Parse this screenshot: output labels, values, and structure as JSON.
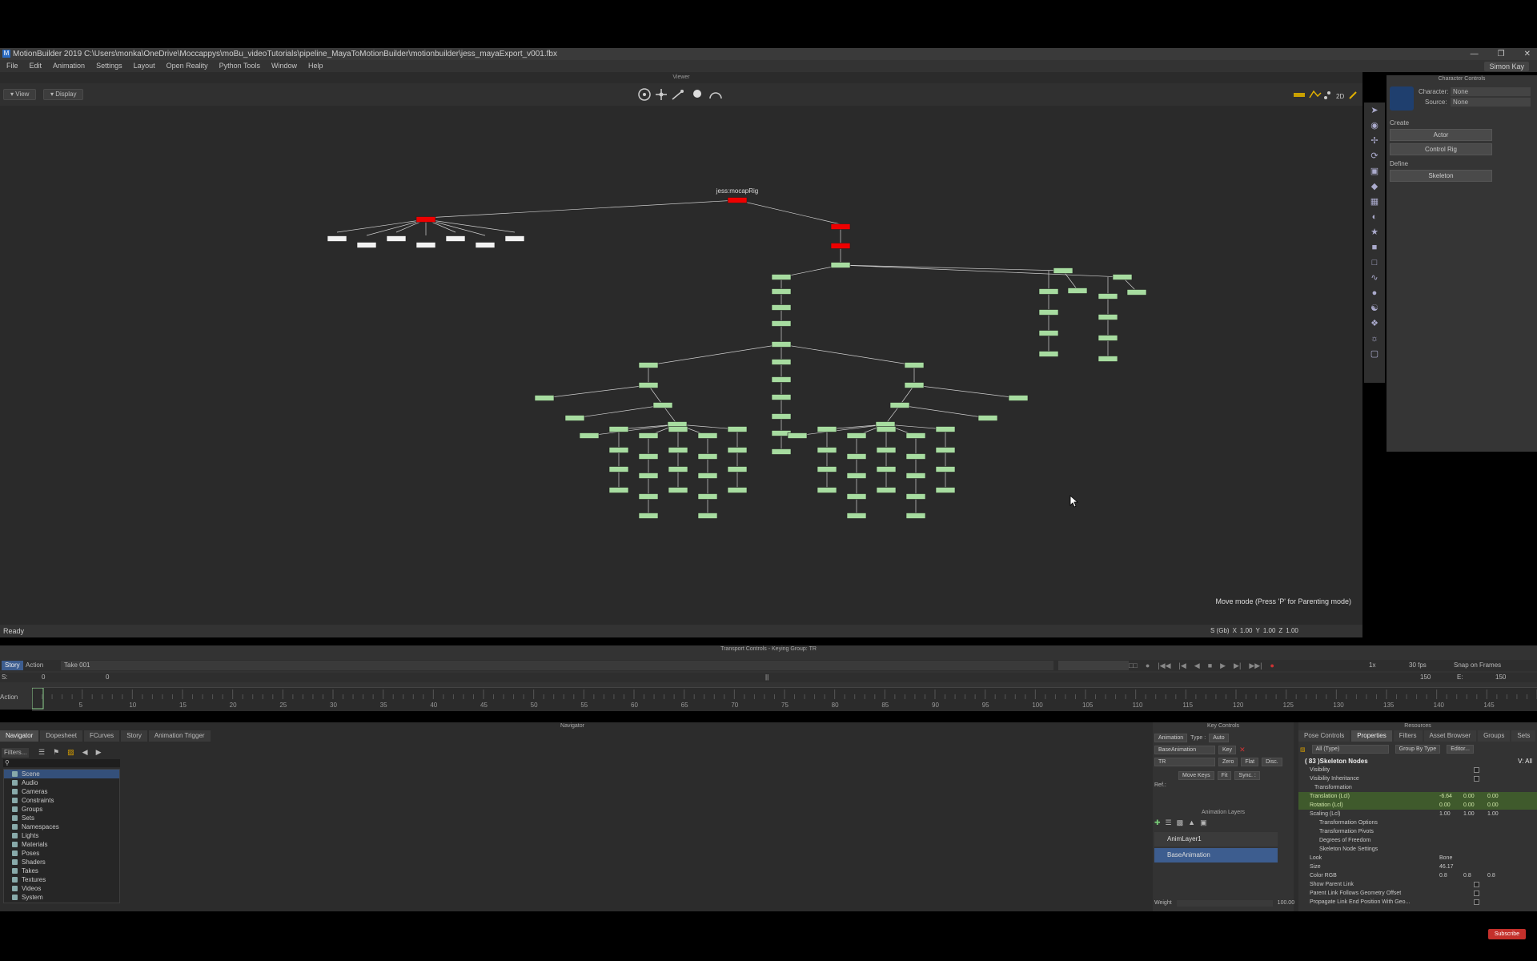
{
  "window": {
    "title": "MotionBuilder 2019    C:\\Users\\monka\\OneDrive\\Moccappys\\moBu_videoTutorials\\pipeline_MayaToMotionBuilder\\motionbuilder\\jess_mayaExport_v001.fbx",
    "user": "Simon Kay"
  },
  "menu": [
    "File",
    "Edit",
    "Animation",
    "Settings",
    "Layout",
    "Open Reality",
    "Python Tools",
    "Window",
    "Help"
  ],
  "viewer": {
    "title": "Viewer",
    "view_label": "View",
    "display_label": "Display",
    "mode_2d": "2D",
    "root_label": "jess:mocapRig",
    "hint": "Move mode (Press 'P' for Parenting mode)"
  },
  "status": {
    "text": "Ready",
    "s_label": "S (Gb)",
    "x_label": "X",
    "x_value": "1.00",
    "y_label": "Y",
    "y_value": "1.00",
    "z_label": "Z",
    "z_value": "1.00"
  },
  "character_controls": {
    "title": "Character Controls",
    "character_label": "Character:",
    "character_value": "None",
    "source_label": "Source:",
    "source_value": "None",
    "create_label": "Create",
    "actor_btn": "Actor",
    "control_rig_btn": "Control Rig",
    "define_label": "Define",
    "skeleton_btn": "Skeleton"
  },
  "transport": {
    "title": "Transport Controls - Keying Group: TR",
    "story_tab": "Story",
    "action_tab": "Action",
    "take": "Take 001",
    "speed": "1x",
    "fps": "30 fps",
    "snap": "Snap on Frames",
    "start_label": "S:",
    "start_value": "0",
    "current_value": "0",
    "end_label": "E:",
    "end_value": "150",
    "end_display": "150",
    "ruler_label": "Action",
    "ticks": [
      "5",
      "10",
      "15",
      "20",
      "25",
      "30",
      "35",
      "40",
      "45",
      "50",
      "55",
      "60",
      "65",
      "70",
      "75",
      "80",
      "85",
      "90",
      "95",
      "100",
      "105",
      "110",
      "115",
      "120",
      "125",
      "130",
      "135",
      "140",
      "145"
    ]
  },
  "navigator": {
    "title": "Navigator",
    "tabs": [
      "Navigator",
      "Dopesheet",
      "FCurves",
      "Story",
      "Animation Trigger"
    ],
    "filter_label": "Filters...",
    "tree": [
      "Scene",
      "Audio",
      "Cameras",
      "Constraints",
      "Groups",
      "Sets",
      "Namespaces",
      "Lights",
      "Materials",
      "Poses",
      "Shaders",
      "Takes",
      "Textures",
      "Videos",
      "System"
    ]
  },
  "key_controls": {
    "title": "Key Controls",
    "animation_label": "Animation",
    "type_label": "Type :",
    "type_value": "Auto",
    "layer_value": "BaseAnimation",
    "key_label": "Key",
    "tr_value": "TR",
    "zero_label": "Zero",
    "flat_label": "Flat",
    "disc_label": "Disc.",
    "move_keys": "Move Keys",
    "fit_label": "Fit",
    "sync_label": "Sync. :",
    "ref_label": "Ref.:",
    "layers_title": "Animation Layers",
    "layers": [
      "AnimLayer1",
      "BaseAnimation"
    ],
    "weight_label": "Weight",
    "weight_value": "100.00"
  },
  "resources": {
    "title": "Resources",
    "tabs": [
      "Pose Controls",
      "Properties",
      "Filters",
      "Asset Browser",
      "Groups",
      "Sets"
    ],
    "type_filter": "All (Type)",
    "group_by": "Group By Type",
    "editor": "Editor...",
    "header": "( 83 )Skeleton Nodes",
    "header_right": "V: All",
    "props": [
      {
        "label": "Visibility",
        "indent": 0
      },
      {
        "label": "Visibility Inheritance",
        "indent": 0
      },
      {
        "label": "Transformation",
        "indent": 1
      },
      {
        "label": "Translation (Lcl)",
        "indent": 0,
        "values": [
          "-6.64",
          "0.00",
          "0.00"
        ],
        "hi": true
      },
      {
        "label": "Rotation (Lcl)",
        "indent": 0,
        "values": [
          "0.00",
          "0.00",
          "0.00"
        ],
        "hi": true
      },
      {
        "label": "Scaling (Lcl)",
        "indent": 0,
        "values": [
          "1.00",
          "1.00",
          "1.00"
        ]
      },
      {
        "label": "Transformation Options",
        "indent": 2
      },
      {
        "label": "Transformation Pivots",
        "indent": 2
      },
      {
        "label": "Degrees of Freedom",
        "indent": 2
      },
      {
        "label": "Skeleton Node Settings",
        "indent": 2
      },
      {
        "label": "Look",
        "indent": 0,
        "value": "Bone"
      },
      {
        "label": "Size",
        "indent": 0,
        "value": "46.17"
      },
      {
        "label": "Color RGB",
        "indent": 0,
        "values": [
          "0.8",
          "0.8",
          "0.8"
        ]
      },
      {
        "label": "Show Parent Link",
        "indent": 0
      },
      {
        "label": "Parent Link Follows Geometry Offset",
        "indent": 0
      },
      {
        "label": "Propagate Link End Position With Geo...",
        "indent": 0
      }
    ]
  },
  "youtube": {
    "subscribe": "Subscribe"
  }
}
